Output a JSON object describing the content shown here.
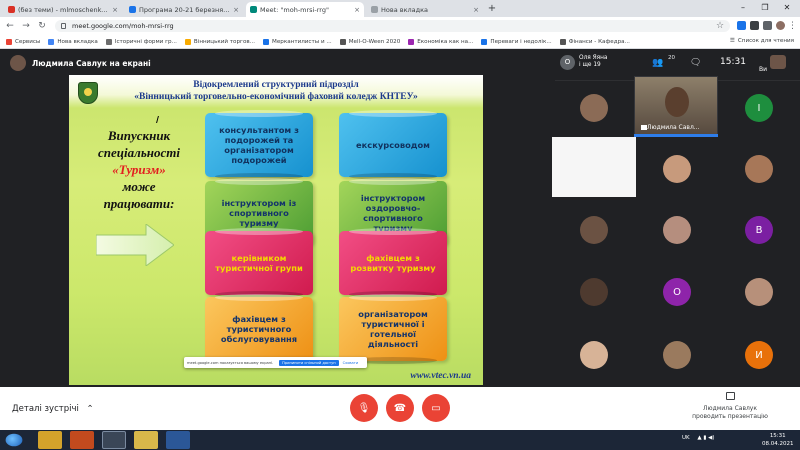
{
  "browser": {
    "tabs": [
      {
        "title": "(без теми) - mlmoschenkom@gm",
        "icon": "gmail-icon",
        "color": "#d93025",
        "active": false
      },
      {
        "title": "Програма 20-21 березня 2021 ро",
        "icon": "docs-icon",
        "color": "#1a73e8",
        "active": false
      },
      {
        "title": "Meet: \"moh-mrsi-rrg\"",
        "icon": "meet-icon",
        "color": "#00897b",
        "active": true
      },
      {
        "title": "Нова вкладка",
        "icon": "newtab-icon",
        "color": "#9aa0a6",
        "active": false
      }
    ],
    "url": "meet.google.com/moh-mrsi-rrg",
    "bookmarks": [
      "Сервисы",
      "Нова вкладка",
      "Історичні форми гр...",
      "Вінницький торгов...",
      "Меркантилисты и ...",
      "Mell-O-Ween 2020",
      "Економіка как на...",
      "Переваги і недолік...",
      "Фінанси - Кафедра..."
    ],
    "bookmarks_other": "Список для чтения"
  },
  "meet": {
    "presenter_label": "Людмила Савлук на екрані",
    "participants_name": "Оля Яяна",
    "participants_more": "і ще 19",
    "participants_count": "20",
    "time": "15:31",
    "self_label": "Ви",
    "big_tile_name": "Людмила Савл...",
    "details_label": "Деталі зустрічі",
    "presenting_line1": "Людмила Савлук",
    "presenting_line2": "проводить презентацію",
    "share_text": "meet.google.com показується вашому екрані.",
    "share_button": "Припинити спільний доступ",
    "share_hide": "Сховати",
    "tiles": [
      {
        "letter": "",
        "color": "#8b6b56"
      },
      {
        "letter": "I",
        "color": "#1e8e3e"
      },
      {
        "letter": "",
        "color": "#c79a7c"
      },
      {
        "letter": "",
        "color": "#a77758"
      },
      {
        "letter": "",
        "color": "#6b5243"
      },
      {
        "letter": "",
        "color": "#b58e7e"
      },
      {
        "letter": "В",
        "color": "#7b1fa2"
      },
      {
        "letter": "",
        "color": "#4e3a2f"
      },
      {
        "letter": "О",
        "color": "#8e24aa"
      },
      {
        "letter": "",
        "color": "#b7907a"
      },
      {
        "letter": "",
        "color": "#d7b397"
      },
      {
        "letter": "",
        "color": "#9a7a5e"
      },
      {
        "letter": "И",
        "color": "#e8710a"
      }
    ]
  },
  "slide": {
    "header_line1": "Відокремлений структурний підрозділ",
    "header_line2": "«Вінницький торговельно-економічний фаховий коледж КНТЕУ»",
    "left_line1": "Випускник",
    "left_line2": "спеціальності",
    "left_line3": "«Туризм»",
    "left_line4": "може",
    "left_line5": "працювати:",
    "ribbons": [
      "консультантом з подорожей та організатором подорожей",
      "екскурсоводом",
      "інструктором із спортивного туризму",
      "інструктором оздоровчо-спортивного туризму",
      "керівником туристичної групи",
      "фахівцем з розвитку туризму",
      "фахівцем з туристичного обслуговування",
      "організатором туристичної і готельної діяльності"
    ],
    "website": "www.vtec.vn.ua"
  },
  "taskbar": {
    "lang": "UK",
    "time": "15:31",
    "date": "08.04.2021"
  },
  "colors": {
    "meet_bg": "#202124",
    "accent": "#1a73e8",
    "hangup": "#ea4335"
  }
}
